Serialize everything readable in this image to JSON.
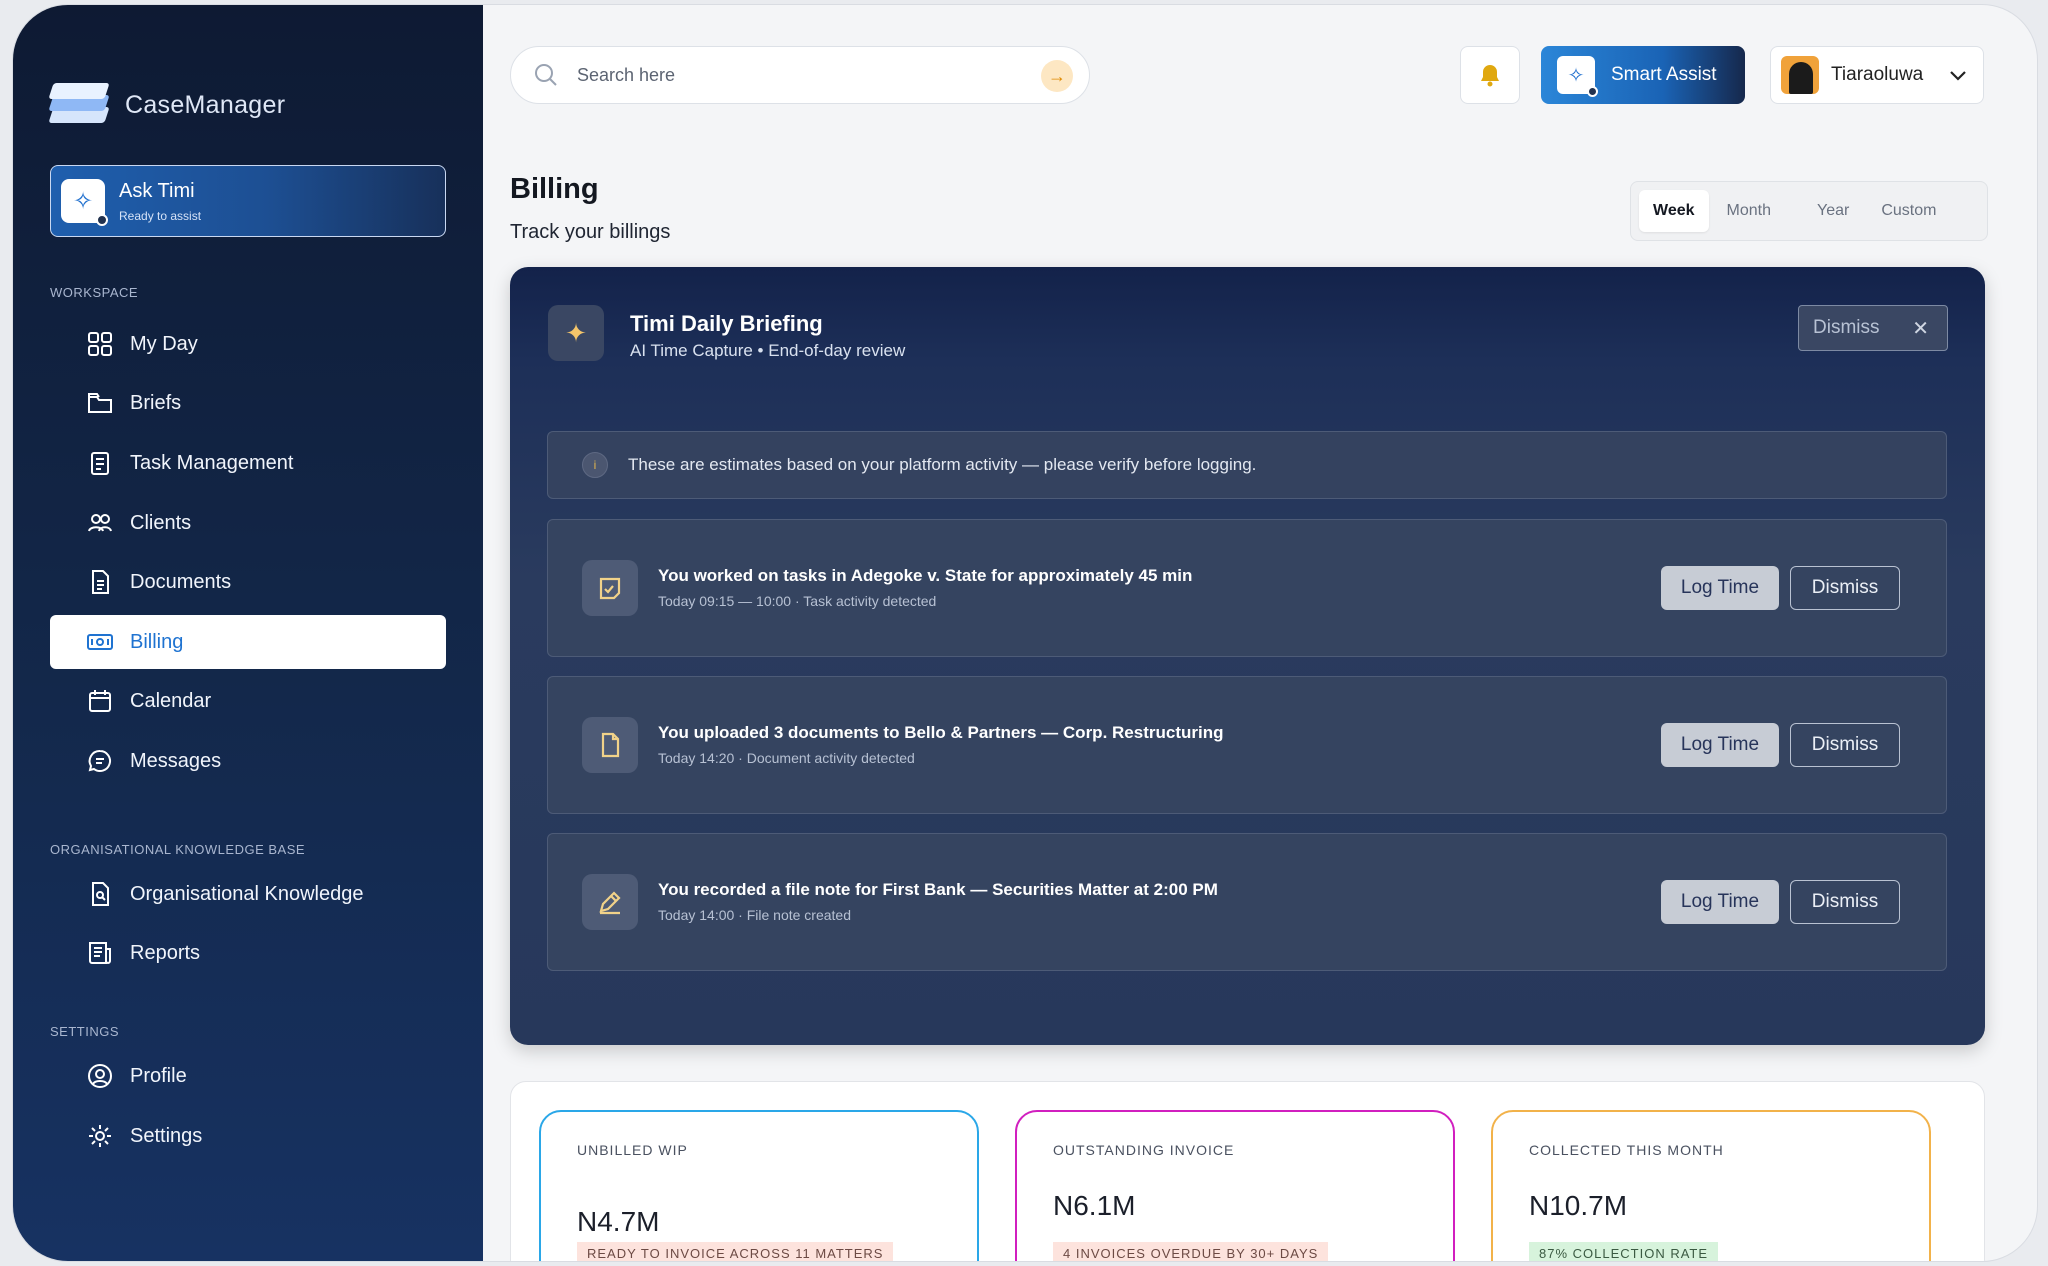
{
  "app": {
    "name": "CaseManager"
  },
  "ask": {
    "title": "Ask Timi",
    "subtitle": "Ready to assist"
  },
  "sidebar": {
    "sections": [
      {
        "label": "WORKSPACE"
      },
      {
        "label": "ORGANISATIONAL KNOWLEDGE BASE"
      },
      {
        "label": "SETTINGS"
      }
    ],
    "items": [
      {
        "label": "My Day",
        "icon": "grid-icon"
      },
      {
        "label": "Briefs",
        "icon": "folder-icon"
      },
      {
        "label": "Task Management",
        "icon": "clipboard-icon"
      },
      {
        "label": "Clients",
        "icon": "users-icon"
      },
      {
        "label": "Documents",
        "icon": "document-icon"
      },
      {
        "label": "Billing",
        "icon": "money-icon",
        "active": true
      },
      {
        "label": "Calendar",
        "icon": "calendar-icon"
      },
      {
        "label": "Messages",
        "icon": "message-icon"
      },
      {
        "label": "Organisational Knowledge",
        "icon": "knowledge-icon"
      },
      {
        "label": "Reports",
        "icon": "reports-icon"
      },
      {
        "label": "Profile",
        "icon": "profile-icon"
      },
      {
        "label": "Settings",
        "icon": "gear-icon"
      }
    ]
  },
  "search": {
    "placeholder": "Search here"
  },
  "header": {
    "smart_assist": "Smart Assist",
    "user_name": "Tiaraoluwa"
  },
  "page": {
    "title": "Billing",
    "subtitle": "Track your billings"
  },
  "period": {
    "options": [
      "Week",
      "Month",
      "Year",
      "Custom"
    ],
    "selected": "Week"
  },
  "briefing": {
    "title": "Timi Daily Briefing",
    "subtitle": "AI Time Capture • End-of-day review",
    "dismiss": "Dismiss",
    "notice": "These are estimates based on your platform activity — please verify before logging.",
    "activities": [
      {
        "title": "You worked on tasks in Adegoke v. State for approximately 45 min",
        "meta": "Today 09:15 — 10:00 · Task activity detected",
        "icon": "task-icon",
        "log": "Log Time",
        "dismiss": "Dismiss"
      },
      {
        "title": "You uploaded 3 documents to Bello & Partners — Corp. Restructuring",
        "meta": "Today 14:20 · Document activity detected",
        "icon": "file-icon",
        "log": "Log Time",
        "dismiss": "Dismiss"
      },
      {
        "title": "You recorded a file note for First Bank — Securities Matter at 2:00 PM",
        "meta": "Today 14:00 · File note created",
        "icon": "pencil-icon",
        "log": "Log Time",
        "dismiss": "Dismiss"
      }
    ]
  },
  "stats": [
    {
      "label": "UNBILLED WIP",
      "value": "N4.7M",
      "badge": "READY TO INVOICE ACROSS 11 MATTERS",
      "color": "#2aa7e8",
      "badge_bg": "#fde3dd",
      "badge_fg": "#6c4a44"
    },
    {
      "label": "OUTSTANDING INVOICE",
      "value": "N6.1M",
      "badge": "4 INVOICES OVERDUE BY 30+ DAYS",
      "color": "#d11fbf",
      "badge_bg": "#fde3dd",
      "badge_fg": "#6c4a44"
    },
    {
      "label": "COLLECTED THIS MONTH",
      "value": "N10.7M",
      "badge": "87% COLLECTION RATE",
      "color": "#f2b24a",
      "badge_bg": "#d7f3dc",
      "badge_fg": "#3b5a42"
    }
  ]
}
